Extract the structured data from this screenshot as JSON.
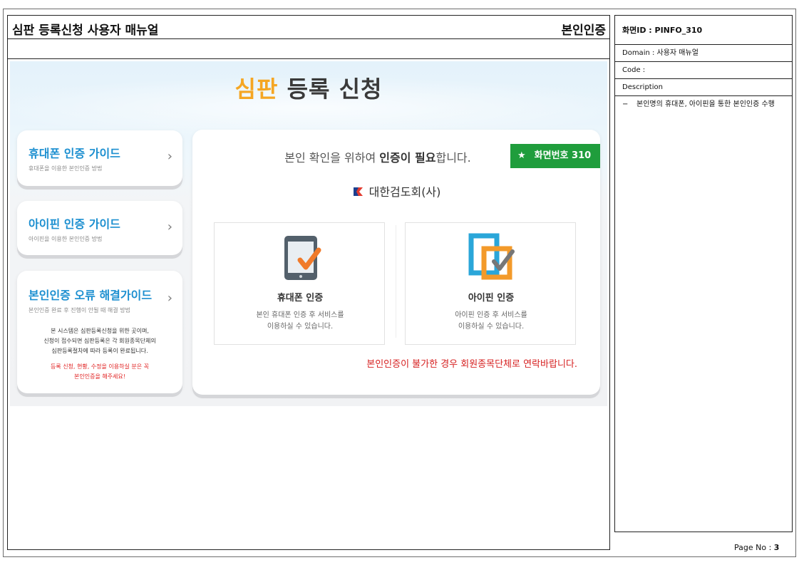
{
  "document": {
    "title": "심판 등록신청 사용자 매뉴얼",
    "section": "본인인증",
    "page_label": "Page No :",
    "page_number": "3"
  },
  "info_panel": {
    "screen_id": "화면ID : PINFO_310",
    "domain": "Domain : 사용자 매뉴얼",
    "code": "Code :",
    "description_label": "Description",
    "description_items": [
      "본인명의 휴대폰, 아이핀을 통한 본인인증 수행"
    ]
  },
  "screen": {
    "hero_title_accent": "심판",
    "hero_title_rest": "등록 신청",
    "left_cards": [
      {
        "title": "휴대폰 인증 가이드",
        "subtitle": "휴대폰을 이용한 본인인증 방법"
      },
      {
        "title": "아이핀 인증 가이드",
        "subtitle": "아이핀을 이용한 본인인증 방법"
      },
      {
        "title": "본인인증 오류 해결가이드",
        "subtitle": "본인인증 완료 후 진행이 안될 때 해결 방법",
        "body_lines": [
          "본 시스템은 심판등록신청을 위한 곳이며,",
          "신청이 접수되면 심판등록은 각 회원종목단체의",
          "심판등록절차에 따라 등록이 완료됩니다."
        ],
        "warning_lines": [
          "등록 신청, 현황, 수정을 이용하실 분은 꼭",
          "본인인증을 해주세요!"
        ]
      }
    ],
    "chevron": "›",
    "need_auth_prefix": "본인 확인을 위하여 ",
    "need_auth_bold": "인증이 필요",
    "need_auth_suffix": "합니다.",
    "badge_star": "★",
    "badge_label": "화면번호 310",
    "org_name": "대한검도회(사)",
    "phone_auth": {
      "title": "휴대폰 인증",
      "desc_line1": "본인 휴대폰 인증 후 서비스를",
      "desc_line2": "이용하실 수 있습니다."
    },
    "ipin_auth": {
      "title": "아이핀 인증",
      "desc_line1": "아이핀 인증 후 서비스를",
      "desc_line2": "이용하실 수 있습니다."
    },
    "warning_text": "본인인증이 불가한 경우 회원종목단체로 연락바랍니다."
  },
  "colors": {
    "accent_orange": "#f5a623",
    "link_blue": "#1c8fd0",
    "badge_green": "#1f9d3c",
    "warning_red": "#d62020"
  },
  "icons": [
    "tablet-check-icon",
    "ipin-check-icon",
    "star-icon",
    "org-logo-icon",
    "chevron-right-icon"
  ]
}
